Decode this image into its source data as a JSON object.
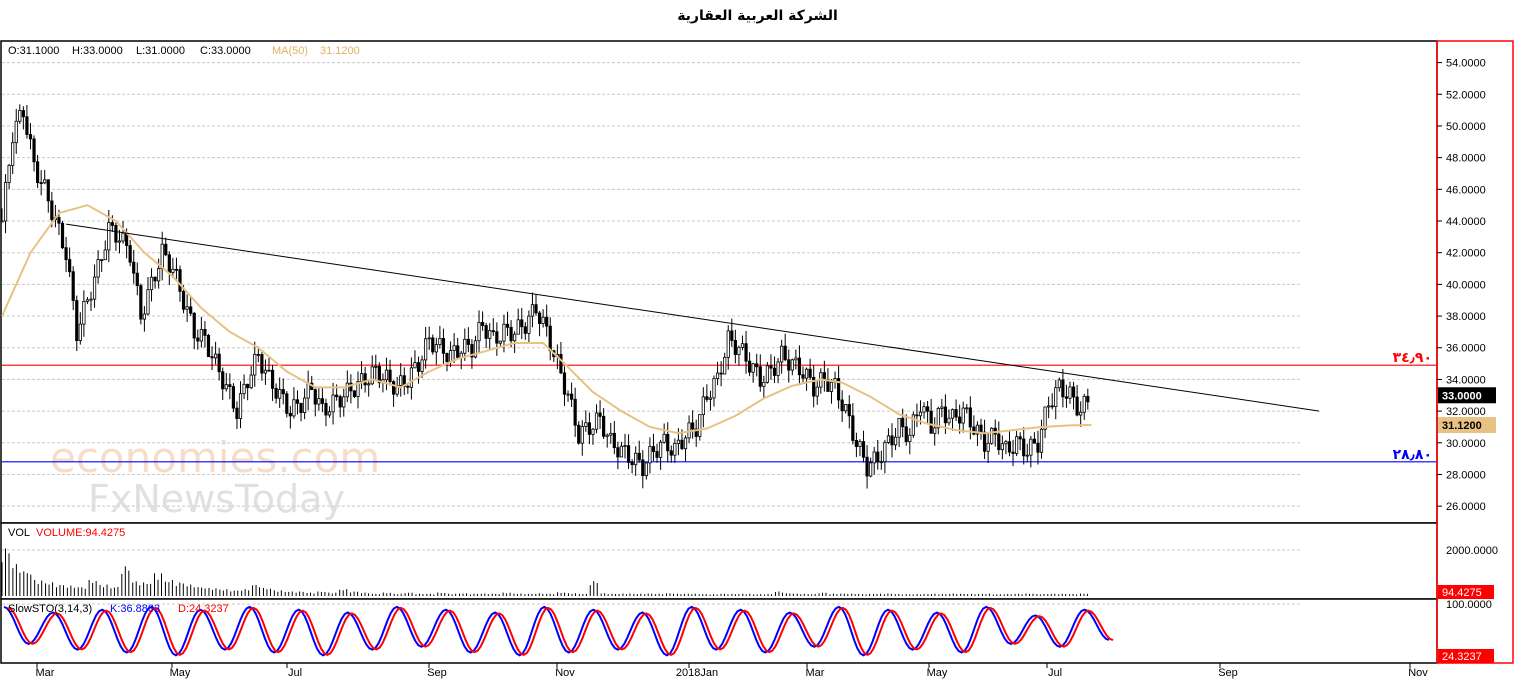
{
  "title": "الشركة العربية العقارية",
  "ohlc_info": {
    "open": "O:31.1000",
    "high": "H:33.0000",
    "low": "L:31.0000",
    "close": "C:33.0000",
    "ma": "MA(50)",
    "ma_value": "31.1200"
  },
  "watermark": {
    "line1": "economies.com",
    "line2": "FxNewsToday"
  },
  "chart_data": [
    {
      "type": "candlestick",
      "panel": "price",
      "y_ticks": [
        "54.0000",
        "52.0000",
        "50.0000",
        "48.0000",
        "46.0000",
        "44.0000",
        "42.0000",
        "40.0000",
        "38.0000",
        "36.0000",
        "34.0000",
        "32.0000",
        "30.0000",
        "28.0000",
        "26.0000"
      ],
      "ylim": [
        25.0,
        55.3
      ],
      "x_ticks": [
        "Mar",
        "May",
        "Jul",
        "Sep",
        "Nov",
        "2018Jan",
        "Mar",
        "May",
        "Jul",
        "Sep",
        "Nov"
      ],
      "close_series": [
        {
          "x": 0,
          "y": 44.0
        },
        {
          "x": 3,
          "y": 49.5
        },
        {
          "x": 6,
          "y": 51.0
        },
        {
          "x": 9,
          "y": 47.5
        },
        {
          "x": 12,
          "y": 46.0
        },
        {
          "x": 15,
          "y": 44.0
        },
        {
          "x": 18,
          "y": 42.0
        },
        {
          "x": 21,
          "y": 37.0
        },
        {
          "x": 24,
          "y": 39.0
        },
        {
          "x": 27,
          "y": 41.0
        },
        {
          "x": 30,
          "y": 43.5
        },
        {
          "x": 33,
          "y": 43.0
        },
        {
          "x": 36,
          "y": 42.0
        },
        {
          "x": 39,
          "y": 38.0
        },
        {
          "x": 42,
          "y": 40.0
        },
        {
          "x": 45,
          "y": 42.0
        },
        {
          "x": 48,
          "y": 41.0
        },
        {
          "x": 51,
          "y": 39.0
        },
        {
          "x": 54,
          "y": 37.0
        },
        {
          "x": 57,
          "y": 36.5
        },
        {
          "x": 60,
          "y": 35.0
        },
        {
          "x": 63,
          "y": 33.5
        },
        {
          "x": 66,
          "y": 32.0
        },
        {
          "x": 69,
          "y": 34.0
        },
        {
          "x": 72,
          "y": 35.5
        },
        {
          "x": 75,
          "y": 34.0
        },
        {
          "x": 78,
          "y": 33.0
        },
        {
          "x": 81,
          "y": 32.0
        },
        {
          "x": 84,
          "y": 32.5
        },
        {
          "x": 87,
          "y": 33.5
        },
        {
          "x": 90,
          "y": 32.0
        },
        {
          "x": 93,
          "y": 32.5
        },
        {
          "x": 96,
          "y": 33.0
        },
        {
          "x": 99,
          "y": 33.5
        },
        {
          "x": 102,
          "y": 34.0
        },
        {
          "x": 105,
          "y": 34.5
        },
        {
          "x": 108,
          "y": 34.0
        },
        {
          "x": 111,
          "y": 33.5
        },
        {
          "x": 114,
          "y": 34.0
        },
        {
          "x": 117,
          "y": 35.0
        },
        {
          "x": 120,
          "y": 36.5
        },
        {
          "x": 123,
          "y": 36.0
        },
        {
          "x": 126,
          "y": 35.5
        },
        {
          "x": 129,
          "y": 36.0
        },
        {
          "x": 132,
          "y": 36.0
        },
        {
          "x": 135,
          "y": 37.5
        },
        {
          "x": 138,
          "y": 36.5
        },
        {
          "x": 141,
          "y": 37.0
        },
        {
          "x": 144,
          "y": 37.0
        },
        {
          "x": 147,
          "y": 37.5
        },
        {
          "x": 150,
          "y": 38.5
        },
        {
          "x": 153,
          "y": 37.0
        },
        {
          "x": 156,
          "y": 35.0
        },
        {
          "x": 159,
          "y": 33.0
        },
        {
          "x": 162,
          "y": 30.5
        },
        {
          "x": 165,
          "y": 31.0
        },
        {
          "x": 168,
          "y": 31.5
        },
        {
          "x": 171,
          "y": 30.0
        },
        {
          "x": 174,
          "y": 29.5
        },
        {
          "x": 177,
          "y": 29.0
        },
        {
          "x": 180,
          "y": 28.5
        },
        {
          "x": 183,
          "y": 29.5
        },
        {
          "x": 186,
          "y": 30.0
        },
        {
          "x": 189,
          "y": 29.5
        },
        {
          "x": 192,
          "y": 30.5
        },
        {
          "x": 195,
          "y": 31.0
        },
        {
          "x": 198,
          "y": 33.0
        },
        {
          "x": 201,
          "y": 34.0
        },
        {
          "x": 204,
          "y": 36.5
        },
        {
          "x": 207,
          "y": 36.0
        },
        {
          "x": 210,
          "y": 35.0
        },
        {
          "x": 213,
          "y": 34.0
        },
        {
          "x": 216,
          "y": 34.5
        },
        {
          "x": 219,
          "y": 35.5
        },
        {
          "x": 222,
          "y": 35.0
        },
        {
          "x": 225,
          "y": 34.5
        },
        {
          "x": 228,
          "y": 33.5
        },
        {
          "x": 231,
          "y": 34.0
        },
        {
          "x": 234,
          "y": 33.5
        },
        {
          "x": 237,
          "y": 32.0
        },
        {
          "x": 240,
          "y": 30.0
        },
        {
          "x": 243,
          "y": 28.5
        },
        {
          "x": 246,
          "y": 29.0
        },
        {
          "x": 249,
          "y": 30.0
        },
        {
          "x": 252,
          "y": 31.0
        },
        {
          "x": 255,
          "y": 30.5
        },
        {
          "x": 258,
          "y": 32.5
        },
        {
          "x": 261,
          "y": 31.0
        },
        {
          "x": 264,
          "y": 32.0
        },
        {
          "x": 267,
          "y": 31.5
        },
        {
          "x": 270,
          "y": 32.0
        },
        {
          "x": 273,
          "y": 31.0
        },
        {
          "x": 276,
          "y": 30.0
        },
        {
          "x": 279,
          "y": 30.5
        },
        {
          "x": 282,
          "y": 29.5
        },
        {
          "x": 285,
          "y": 30.0
        },
        {
          "x": 288,
          "y": 29.5
        },
        {
          "x": 291,
          "y": 30.0
        },
        {
          "x": 294,
          "y": 32.5
        },
        {
          "x": 297,
          "y": 33.5
        },
        {
          "x": 300,
          "y": 33.0
        },
        {
          "x": 303,
          "y": 32.0
        },
        {
          "x": 306,
          "y": 33.0
        }
      ],
      "ma50_series": [
        {
          "x": 0,
          "y": 38.0
        },
        {
          "x": 8,
          "y": 42.0
        },
        {
          "x": 16,
          "y": 44.5
        },
        {
          "x": 24,
          "y": 45.0
        },
        {
          "x": 32,
          "y": 44.0
        },
        {
          "x": 40,
          "y": 42.0
        },
        {
          "x": 48,
          "y": 40.5
        },
        {
          "x": 56,
          "y": 38.5
        },
        {
          "x": 64,
          "y": 37.0
        },
        {
          "x": 72,
          "y": 36.0
        },
        {
          "x": 80,
          "y": 34.5
        },
        {
          "x": 88,
          "y": 33.5
        },
        {
          "x": 96,
          "y": 33.5
        },
        {
          "x": 104,
          "y": 34.0
        },
        {
          "x": 112,
          "y": 33.5
        },
        {
          "x": 120,
          "y": 34.5
        },
        {
          "x": 128,
          "y": 35.3
        },
        {
          "x": 136,
          "y": 35.8
        },
        {
          "x": 144,
          "y": 36.3
        },
        {
          "x": 152,
          "y": 36.3
        },
        {
          "x": 158,
          "y": 35.0
        },
        {
          "x": 166,
          "y": 33.2
        },
        {
          "x": 174,
          "y": 32.0
        },
        {
          "x": 182,
          "y": 31.0
        },
        {
          "x": 190,
          "y": 30.6
        },
        {
          "x": 198,
          "y": 30.9
        },
        {
          "x": 206,
          "y": 31.7
        },
        {
          "x": 214,
          "y": 32.8
        },
        {
          "x": 222,
          "y": 33.6
        },
        {
          "x": 230,
          "y": 34.0
        },
        {
          "x": 236,
          "y": 33.8
        },
        {
          "x": 244,
          "y": 32.9
        },
        {
          "x": 252,
          "y": 31.8
        },
        {
          "x": 260,
          "y": 31.2
        },
        {
          "x": 268,
          "y": 30.8
        },
        {
          "x": 276,
          "y": 30.6
        },
        {
          "x": 284,
          "y": 30.8
        },
        {
          "x": 292,
          "y": 31.0
        },
        {
          "x": 300,
          "y": 31.1
        },
        {
          "x": 306,
          "y": 31.12
        }
      ],
      "trend_line": {
        "from": {
          "x": 18,
          "y": 43.8
        },
        "to": {
          "x": 370,
          "y": 32.0
        }
      },
      "resistance": {
        "value": 34.9,
        "label": "٣٤٫٩٠",
        "color": "#ff0000"
      },
      "support": {
        "value": 28.8,
        "label": "٢٨٫٨٠",
        "color": "#0000ff"
      },
      "last_price": {
        "value": 33.0,
        "label": "33.0000"
      },
      "ma_label": {
        "value": 31.12,
        "label": "31.1200"
      },
      "colors": {
        "candles": "#000000",
        "ma": "#e8c284",
        "trend": "#000000",
        "border": "#ff0000"
      },
      "grid": true,
      "x_max": 380
    },
    {
      "type": "bar",
      "panel": "volume",
      "name": "VOL",
      "label": "VOLUME:94.4275",
      "y_ticks": [
        "2000.0000"
      ],
      "ylim": [
        0,
        3000
      ],
      "values": [
        2100,
        1400,
        1100,
        700,
        600,
        500,
        450,
        400,
        700,
        500,
        400,
        1300,
        650,
        600,
        1000,
        700,
        600,
        500,
        400,
        350,
        300,
        250,
        300,
        500,
        350,
        250,
        200,
        200,
        150,
        200,
        150,
        300,
        200,
        150,
        100,
        150,
        100,
        150,
        100,
        100,
        150,
        100,
        120,
        100,
        110,
        100,
        150,
        110,
        100,
        120,
        100,
        160,
        120,
        100,
        650,
        120,
        100,
        110,
        100,
        110,
        100,
        120,
        100,
        100,
        90,
        80,
        100,
        90,
        100,
        80,
        90,
        200,
        120,
        100,
        90,
        150,
        100,
        110,
        100,
        90,
        100,
        110,
        90,
        80,
        90,
        100,
        90,
        110,
        100,
        90,
        100,
        80,
        90,
        100,
        110,
        90,
        100,
        100,
        90,
        110
      ],
      "last_value": {
        "label": "94.4275"
      }
    },
    {
      "type": "line",
      "panel": "stochastic",
      "name": "SlowSTO(3,14,3)",
      "k_label": "K:36.8803",
      "d_label": "D:24.3237",
      "y_ticks": [
        "100.0000"
      ],
      "ylim": [
        0,
        100
      ],
      "last_value": {
        "label": "24.3237"
      },
      "cycle_points": [
        95,
        30,
        85,
        20,
        90,
        15,
        95,
        10,
        90,
        20,
        95,
        15,
        90,
        10,
        85,
        20,
        95,
        25,
        90,
        15,
        85,
        10,
        95,
        15,
        90,
        20,
        85,
        10,
        95,
        20,
        90,
        15,
        85,
        25,
        95,
        10,
        90,
        20,
        85,
        15,
        95,
        30,
        80,
        25,
        90,
        36.9
      ],
      "colors": {
        "k": "#0000ff",
        "d": "#ff0000"
      }
    }
  ]
}
